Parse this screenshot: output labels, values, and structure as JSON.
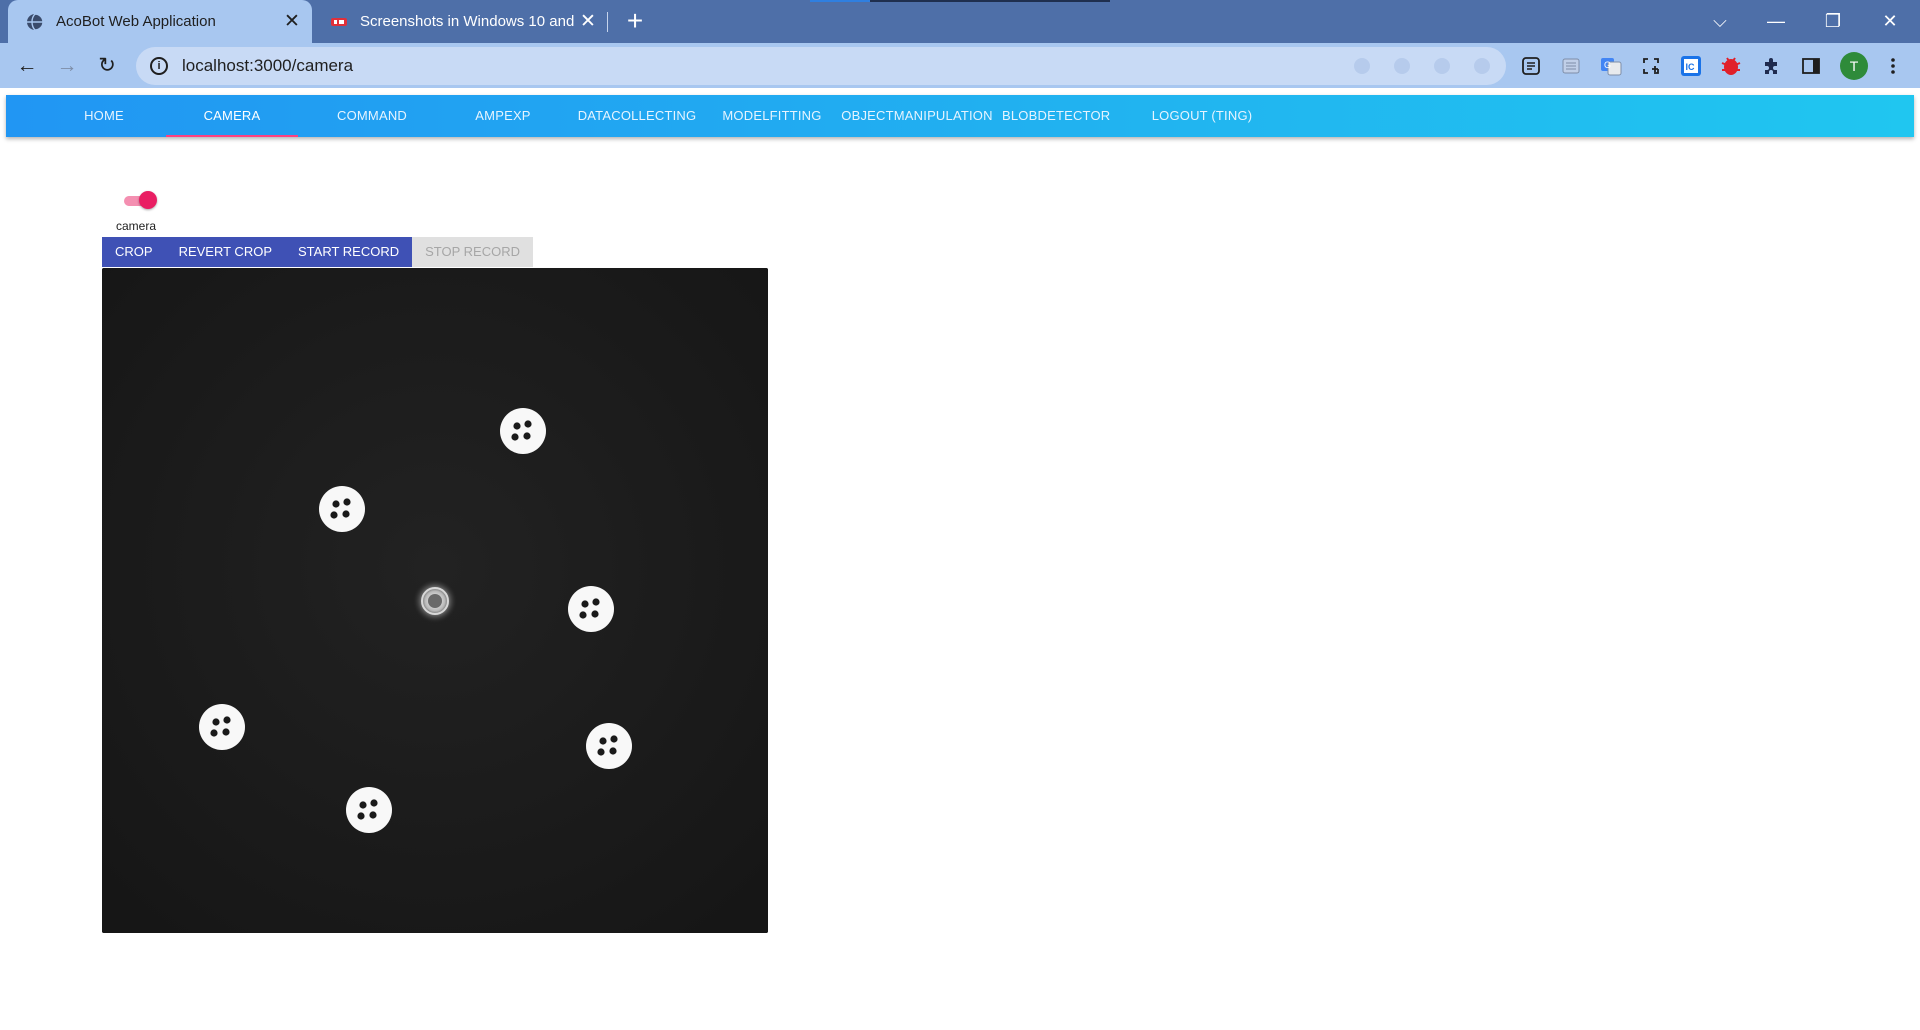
{
  "browser": {
    "tabs": [
      {
        "title": "AcoBot Web Application",
        "active": true
      },
      {
        "title": "Screenshots in Windows 10 and \\",
        "active": false
      }
    ],
    "address": "localhost:3000/camera",
    "profile_initial": "T"
  },
  "colors": {
    "nav_gradient_start": "#2196f3",
    "nav_gradient_end": "#20c6f0",
    "active_indicator": "#ff4081",
    "button_primary": "#3f51b5",
    "toggle_on": "#e91e63",
    "camera_background": "#1b1b1b"
  },
  "nav": {
    "items": [
      {
        "label": "HOME"
      },
      {
        "label": "CAMERA",
        "active": true
      },
      {
        "label": "COMMAND"
      },
      {
        "label": "AMPEXP"
      },
      {
        "label": "DATACOLLECTING"
      },
      {
        "label": "MODELFITTING"
      },
      {
        "label": "OBJECTMANIPULATION"
      },
      {
        "label": "BLOBDETECTOR"
      },
      {
        "label": "LOGOUT (TING)"
      }
    ]
  },
  "camera": {
    "toggle_label": "camera",
    "toggle_on": true
  },
  "actions": {
    "crop": "CROP",
    "revert_crop": "REVERT CROP",
    "start_record": "START RECORD",
    "stop_record": "STOP RECORD"
  }
}
